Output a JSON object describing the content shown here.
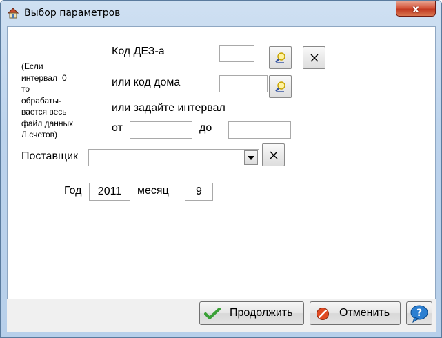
{
  "window": {
    "title": "Выбор параметров",
    "close_glyph": "x"
  },
  "form": {
    "note_lines": [
      "(Если",
      "интервал=0",
      "то",
      "обрабаты-",
      "вается весь",
      "файл данных",
      "Л.счетов)"
    ],
    "dez_label": "Код ДЕЗ-а",
    "dez_value": "",
    "house_label": "или код дома",
    "house_value": "",
    "interval_label": "или задайте интервал",
    "from_label": "от",
    "from_value": "",
    "to_label": "до",
    "to_value": "",
    "supplier_label": "Поставщик",
    "supplier_value": "",
    "year_label": "Год",
    "year_value": "2011",
    "month_label": "месяц",
    "month_value": "9"
  },
  "footer": {
    "continue_label": "Продолжить",
    "cancel_label": "Отменить"
  },
  "icons": {
    "title": "house-icon",
    "search": "search-icon",
    "clear": "close-icon",
    "dropdown": "chevron-down-icon",
    "continue": "checkmark-icon",
    "cancel": "no-entry-icon",
    "help": "help-bubble-icon"
  }
}
